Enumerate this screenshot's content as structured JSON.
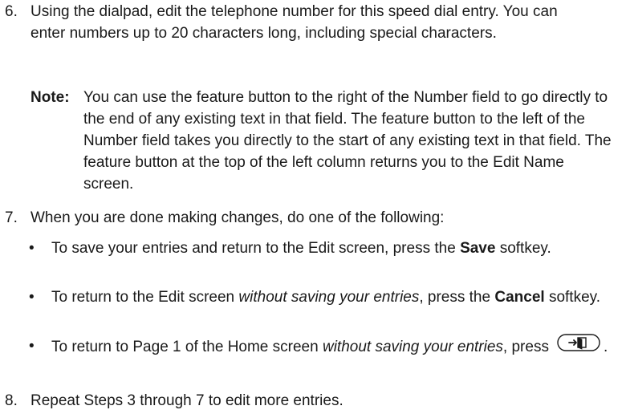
{
  "steps": {
    "s6": {
      "num": "6.",
      "text": "Using the dialpad, edit the telephone number for this speed dial entry. You can enter numbers up to 20 characters long, including special characters."
    },
    "note": {
      "label": "Note:",
      "text": "You can use the feature button to the right of the Number field to go directly to the end of any existing text in that field. The feature button to the left of the Number field takes you directly to the start of any existing text in that field. The feature button at the top of the left column returns you to the Edit Name screen."
    },
    "s7": {
      "num": "7.",
      "text": "When you are done making changes, do one of the following:"
    },
    "bullets": {
      "b1": {
        "pre": "To save your entries and return to the Edit screen, press the ",
        "bold": "Save",
        "post": " softkey."
      },
      "b2": {
        "pre": "To return to the Edit screen ",
        "italic": "without saving your entries",
        "mid": ", press the ",
        "bold": "Cancel",
        "post": " softkey."
      },
      "b3": {
        "pre": "To return to Page 1 of the Home screen ",
        "italic": "without saving your entries",
        "mid": ", press",
        "post": ".",
        "icon": "exit-key-icon"
      }
    },
    "s8": {
      "num": "8.",
      "text": "Repeat Steps 3 through 7 to edit more entries."
    }
  }
}
